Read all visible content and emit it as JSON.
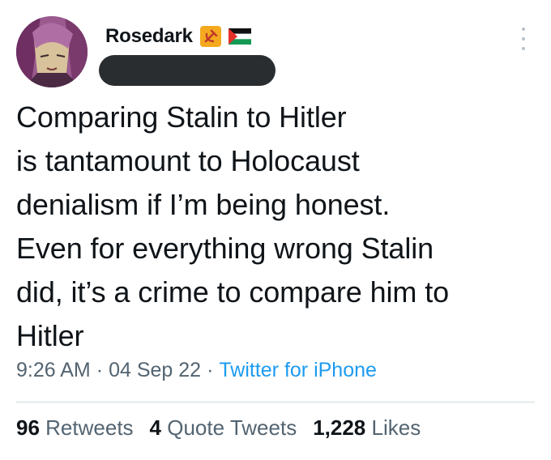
{
  "author": {
    "display_name": "Rosedark",
    "badges": [
      "hammer-sickle-emoji",
      "palestine-flag-emoji"
    ],
    "handle_redacted": true
  },
  "tweet": {
    "text_lines": [
      "Comparing Stalin to Hitler",
      "is tantamount to Holocaust",
      "denialism if I’m being honest.",
      "Even for everything wrong Stalin",
      "did, it’s a crime to compare him to",
      "Hitler"
    ]
  },
  "meta": {
    "time": "9:26 AM",
    "date": "04 Sep 22",
    "source": "Twitter for iPhone",
    "separator": "·"
  },
  "stats": {
    "retweets": {
      "count": "96",
      "label": "Retweets"
    },
    "quote_tweets": {
      "count": "4",
      "label": "Quote Tweets"
    },
    "likes": {
      "count": "1,228",
      "label": "Likes"
    }
  },
  "colors": {
    "text": "#0f1419",
    "secondary": "#536471",
    "link": "#1d9bf0",
    "redaction": "#2a2d30",
    "divider": "#cfd9de"
  }
}
